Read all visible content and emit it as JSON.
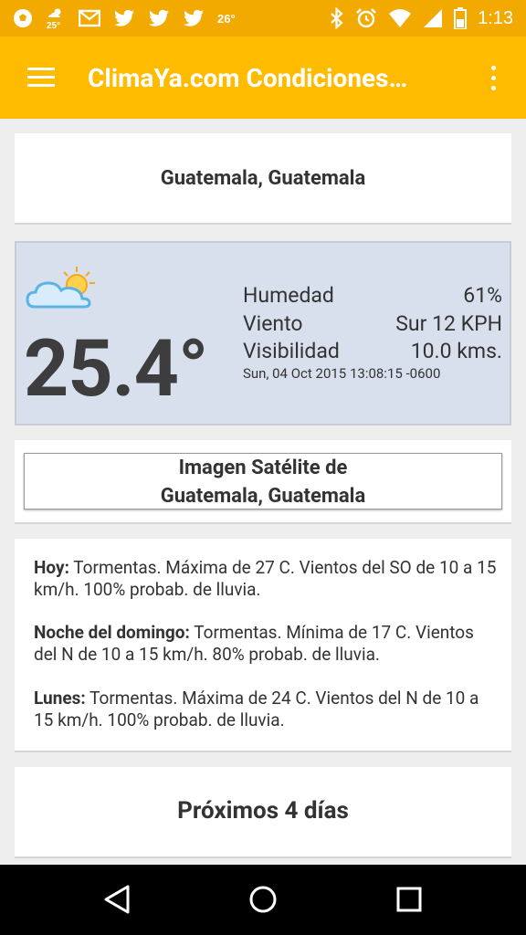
{
  "status_bar": {
    "weather_temp_small": "25°",
    "temp_text": "26°",
    "time": "1:13"
  },
  "app_bar": {
    "title": "ClimaYa.com Condiciones…"
  },
  "location": {
    "title": "Guatemala, Guatemala"
  },
  "weather": {
    "icon": "partly-sunny-cloud-icon",
    "temperature": "25.4°",
    "humidity_label": "Humedad",
    "humidity_value": "61%",
    "wind_label": "Viento",
    "wind_value": "Sur 12 KPH",
    "visibility_label": "Visibilidad",
    "visibility_value": "10.0 kms.",
    "timestamp": "Sun, 04 Oct 2015 13:08:15 -0600"
  },
  "satellite": {
    "line1": "Imagen Satélite de",
    "line2": "Guatemala, Guatemala"
  },
  "forecast": [
    {
      "day": "Hoy:",
      "text": "Tormentas. Máxima de 27 C. Vientos del SO de 10 a 15 km/h. 100% probab. de lluvia."
    },
    {
      "day": "Noche del domingo:",
      "text": "Tormentas. Mínima de 17 C. Vientos del N de 10 a 15 km/h. 80% probab. de lluvia."
    },
    {
      "day": "Lunes:",
      "text": "Tormentas. Máxima de 24 C. Vientos del N de 10 a 15 km/h. 100% probab. de lluvia."
    }
  ],
  "next_days": {
    "title": "Próximos 4 días"
  },
  "colors": {
    "status_bar": "#f2a900",
    "app_bar": "#ffbb00",
    "weather_card": "#d9e0ed"
  }
}
